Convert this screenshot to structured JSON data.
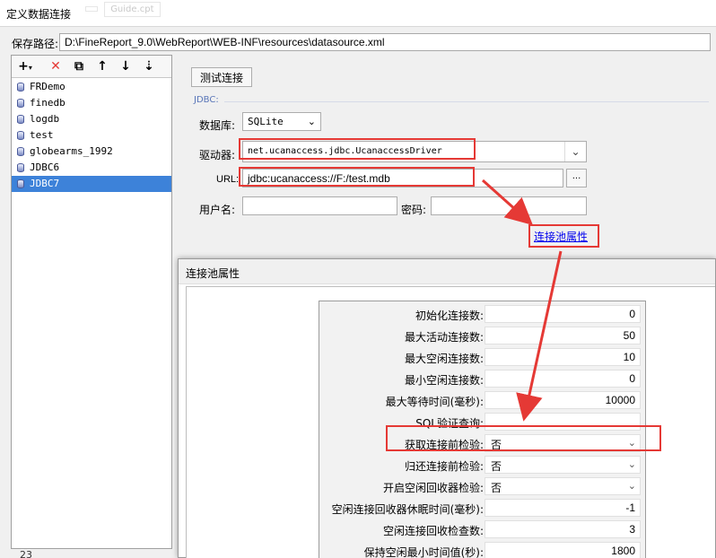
{
  "window": {
    "title": "定义数据连接",
    "ghost_tabs": [
      "",
      "Guide.cpt"
    ]
  },
  "path": {
    "label": "保存路径:",
    "value": "D:\\FineReport_9.0\\WebReport\\WEB-INF\\resources\\datasource.xml"
  },
  "toolbar": {
    "add": "+",
    "delete": "✕",
    "copy": "⧉",
    "up": "↑",
    "down": "↓",
    "sort": "⇣"
  },
  "connections": [
    {
      "name": "FRDemo"
    },
    {
      "name": "finedb"
    },
    {
      "name": "logdb"
    },
    {
      "name": "test"
    },
    {
      "name": "globearms_1992"
    },
    {
      "name": "JDBC6"
    },
    {
      "name": "JDBC7"
    }
  ],
  "selected_connection": "JDBC7",
  "config": {
    "test_button": "测试连接",
    "group_label": "JDBC:",
    "db_label": "数据库:",
    "db_value": "SQLite",
    "driver_label": "驱动器:",
    "driver_value": "net.ucanaccess.jdbc.UcanaccessDriver",
    "url_label": "URL:",
    "url_value": "jdbc:ucanaccess://F:/test.mdb",
    "url_browse": "...",
    "user_label": "用户名:",
    "password_label": "密码:",
    "pool_link": "连接池属性"
  },
  "pool": {
    "title": "连接池属性",
    "rows": [
      {
        "name": "初始化连接数:",
        "value": "0"
      },
      {
        "name": "最大活动连接数:",
        "value": "50"
      },
      {
        "name": "最大空闲连接数:",
        "value": "10"
      },
      {
        "name": "最小空闲连接数:",
        "value": "0"
      },
      {
        "name": "最大等待时间(毫秒):",
        "value": "10000"
      },
      {
        "name": "SQL验证查询:",
        "value": ""
      },
      {
        "name": "获取连接前检验:",
        "value": "否",
        "select": true
      },
      {
        "name": "归还连接前检验:",
        "value": "否",
        "select": true
      },
      {
        "name": "开启空闲回收器检验:",
        "value": "否",
        "select": true
      },
      {
        "name": "空闲连接回收器休眠时间(毫秒):",
        "value": "-1"
      },
      {
        "name": "空闲连接回收检查数:",
        "value": "3"
      },
      {
        "name": "保持空闲最小时间值(秒):",
        "value": "1800"
      }
    ]
  },
  "footer": {
    "line_number": "23"
  },
  "colors": {
    "highlight": "#e53935",
    "selection": "#3d82d9",
    "link": "#0000ee"
  }
}
